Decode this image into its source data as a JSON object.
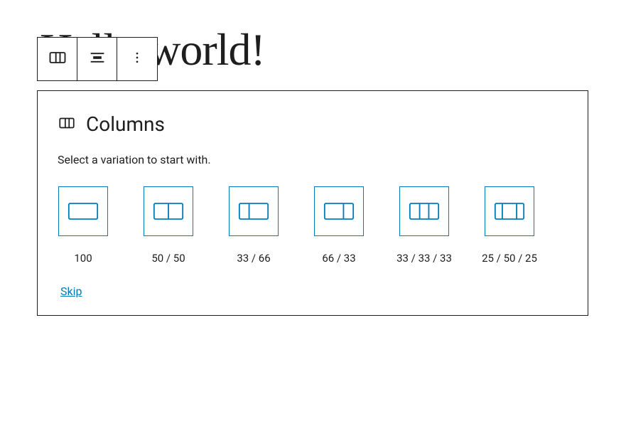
{
  "heading": "Hello world!",
  "toolbar": {
    "block_type_label": "Columns",
    "align_label": "Change alignment",
    "more_label": "More options"
  },
  "placeholder": {
    "title": "Columns",
    "instructions": "Select a variation to start with.",
    "skip_label": "Skip",
    "variations": [
      {
        "key": "100",
        "label": "100",
        "icon": "col-100"
      },
      {
        "key": "50-50",
        "label": "50 / 50",
        "icon": "col-50-50"
      },
      {
        "key": "33-66",
        "label": "33 / 66",
        "icon": "col-33-66"
      },
      {
        "key": "66-33",
        "label": "66 / 33",
        "icon": "col-66-33"
      },
      {
        "key": "33-33-33",
        "label": "33 / 33 / 33",
        "icon": "col-33-33-33"
      },
      {
        "key": "25-50-25",
        "label": "25 / 50 / 25",
        "icon": "col-25-50-25"
      }
    ]
  },
  "colors": {
    "accent": "#007cba",
    "border": "#1e1e1e"
  }
}
